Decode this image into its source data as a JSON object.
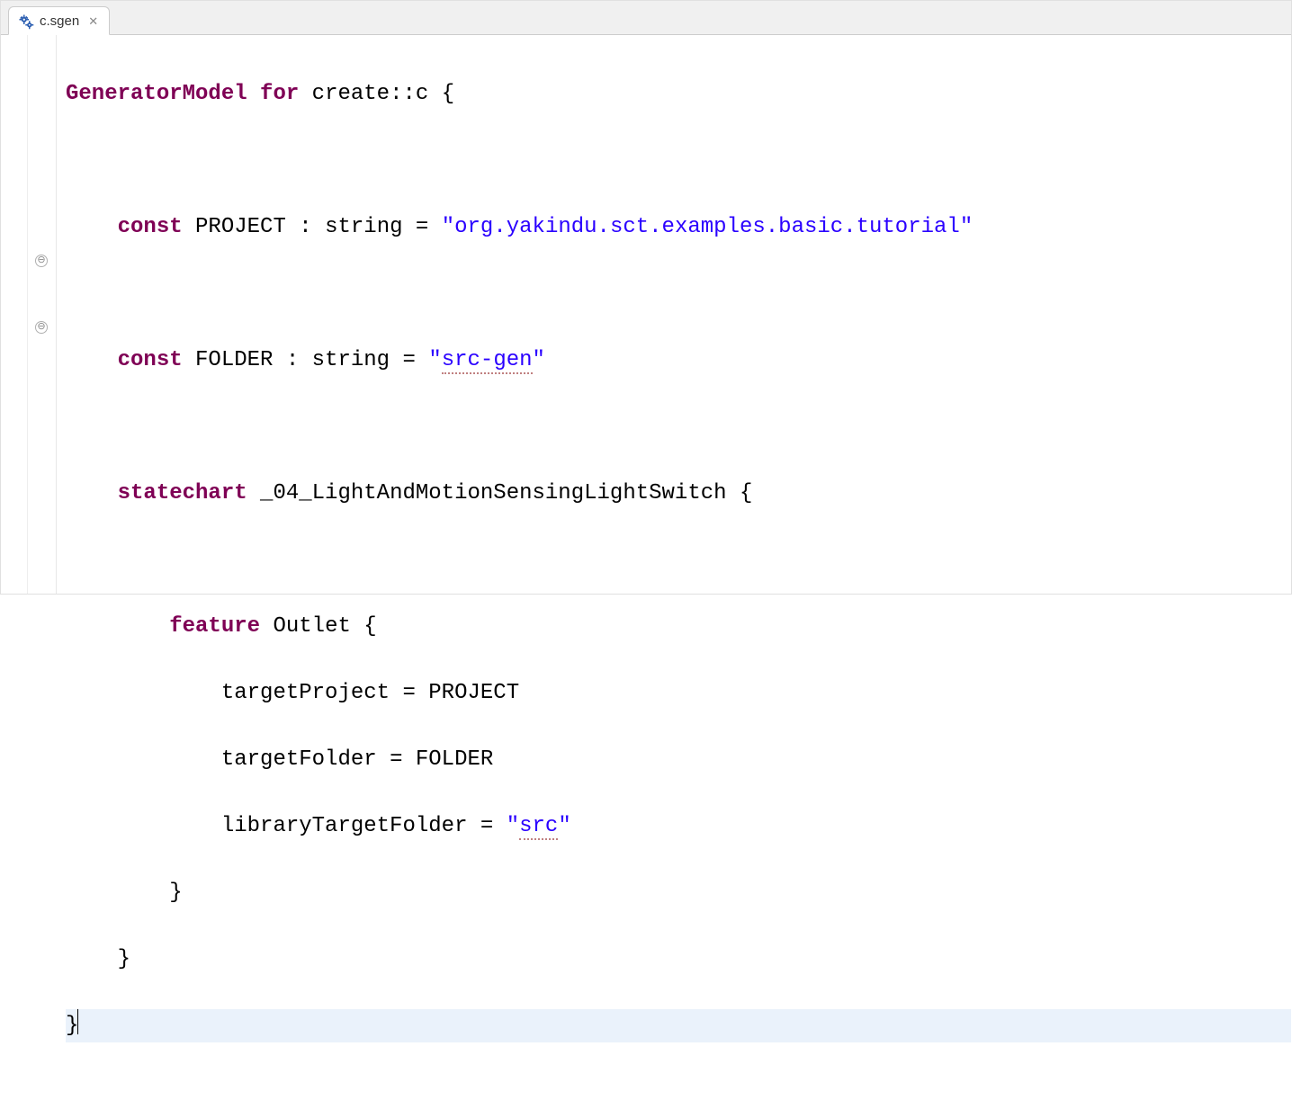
{
  "tab": {
    "title": "c.sgen",
    "close_glyph": "✕"
  },
  "fold": {
    "glyph_minus": "⊖"
  },
  "code": {
    "kw_generatorModel": "GeneratorModel",
    "kw_for": "for",
    "qual": "create::c",
    "kw_const": "const",
    "const1_name": "PROJECT",
    "type_string": "string",
    "const1_val": "\"org.yakindu.sct.examples.basic.tutorial\"",
    "const2_name": "FOLDER",
    "const2_val_q1": "\"",
    "const2_val_txt": "src-gen",
    "const2_val_q2": "\"",
    "kw_statechart": "statechart",
    "statechart_name": "_04_LightAndMotionSensingLightSwitch",
    "kw_feature": "feature",
    "feature_name": "Outlet",
    "prop1": "targetProject",
    "prop1_val": "PROJECT",
    "prop2": "targetFolder",
    "prop2_val": "FOLDER",
    "prop3": "libraryTargetFolder",
    "prop3_val_q1": "\"",
    "prop3_val_txt": "src",
    "prop3_val_q2": "\""
  }
}
